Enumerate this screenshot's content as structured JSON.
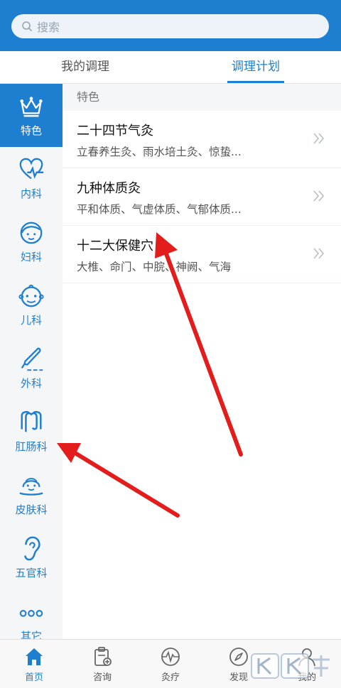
{
  "search": {
    "placeholder": "搜索"
  },
  "tabs": [
    {
      "label": "我的调理",
      "active": false
    },
    {
      "label": "调理计划",
      "active": true
    }
  ],
  "sidebar": {
    "items": [
      {
        "label": "特色",
        "icon": "crown-icon",
        "active": true
      },
      {
        "label": "内科",
        "icon": "heart-pulse-icon",
        "active": false
      },
      {
        "label": "妇科",
        "icon": "woman-face-icon",
        "active": false
      },
      {
        "label": "儿科",
        "icon": "baby-face-icon",
        "active": false
      },
      {
        "label": "外科",
        "icon": "scalpel-icon",
        "active": false
      },
      {
        "label": "肛肠科",
        "icon": "intestine-icon",
        "active": false
      },
      {
        "label": "皮肤科",
        "icon": "skin-face-icon",
        "active": false
      },
      {
        "label": "五官科",
        "icon": "ear-icon",
        "active": false
      },
      {
        "label": "其它",
        "icon": "more-dots-icon",
        "active": false
      }
    ]
  },
  "section": {
    "title": "特色"
  },
  "list": [
    {
      "title": "二十四节气灸",
      "subtitle": "立春养生灸、雨水培土灸、惊蛰..."
    },
    {
      "title": "九种体质灸",
      "subtitle": "平和体质、气虚体质、气郁体质..."
    },
    {
      "title": "十二大保健穴",
      "subtitle": "大椎、命门、中脘、神阙、气海"
    }
  ],
  "bottom_nav": [
    {
      "label": "首页",
      "icon": "home-icon",
      "active": true
    },
    {
      "label": "咨询",
      "icon": "consult-icon",
      "active": false
    },
    {
      "label": "灸疗",
      "icon": "moxibustion-icon",
      "active": false
    },
    {
      "label": "发现",
      "icon": "compass-icon",
      "active": false
    },
    {
      "label": "我的",
      "icon": "user-icon",
      "active": false
    }
  ],
  "colors": {
    "accent": "#1e7fd0",
    "arrow": "#e31c1c"
  }
}
